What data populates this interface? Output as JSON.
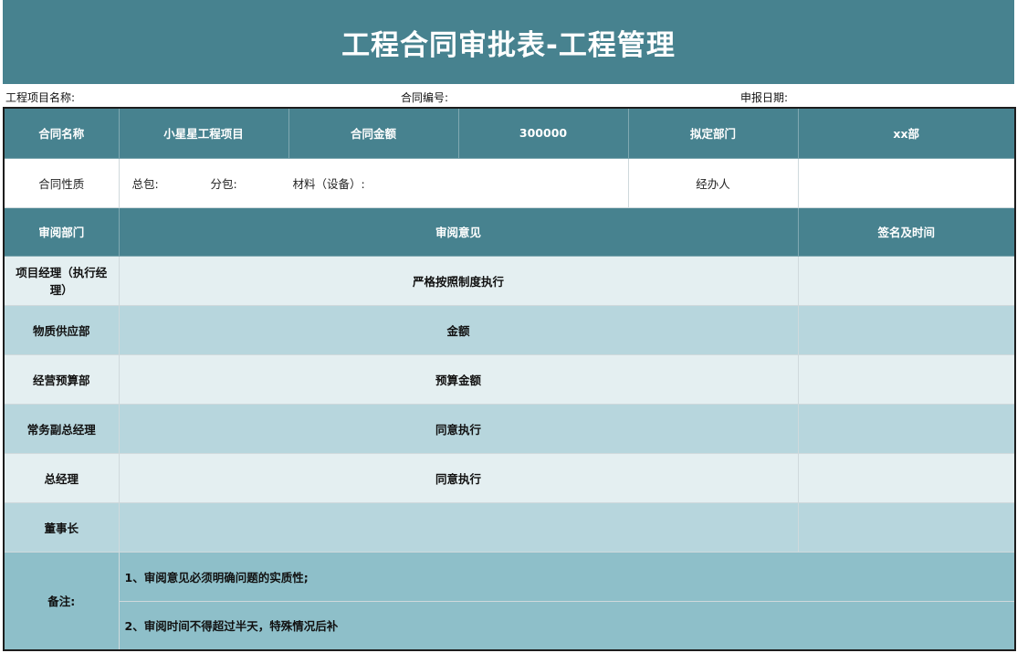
{
  "title": "工程合同审批表-工程管理",
  "meta": {
    "project_name_label": "工程项目名称:",
    "contract_no_label": "合同编号:",
    "report_date_label": "申报日期:"
  },
  "contract": {
    "name_label": "合同名称",
    "name_value": "小星星工程项目",
    "amount_label": "合同金额",
    "amount_value": "300000",
    "dept_label": "拟定部门",
    "dept_value": "xx部",
    "nature_label": "合同性质",
    "general": "总包:",
    "sub": "分包:",
    "material": "材料（设备）:",
    "handler_label": "经办人",
    "handler_value": ""
  },
  "review": {
    "col_dept": "审阅部门",
    "col_opinion": "审阅意见",
    "col_sign": "签名及时间",
    "rows": [
      {
        "dept": "项目经理（执行经理）",
        "opinion": "严格按照制度执行",
        "sign": ""
      },
      {
        "dept": "物质供应部",
        "opinion": "金额",
        "sign": ""
      },
      {
        "dept": "经营预算部",
        "opinion": "预算金额",
        "sign": ""
      },
      {
        "dept": "常务副总经理",
        "opinion": "同意执行",
        "sign": ""
      },
      {
        "dept": "总经理",
        "opinion": "同意执行",
        "sign": ""
      },
      {
        "dept": "董事长",
        "opinion": "",
        "sign": ""
      }
    ]
  },
  "notes": {
    "label": "备注:",
    "items": [
      "1、审阅意见必须明确问题的实质性;",
      "2、审阅时间不得超过半天，特殊情况后补"
    ]
  }
}
